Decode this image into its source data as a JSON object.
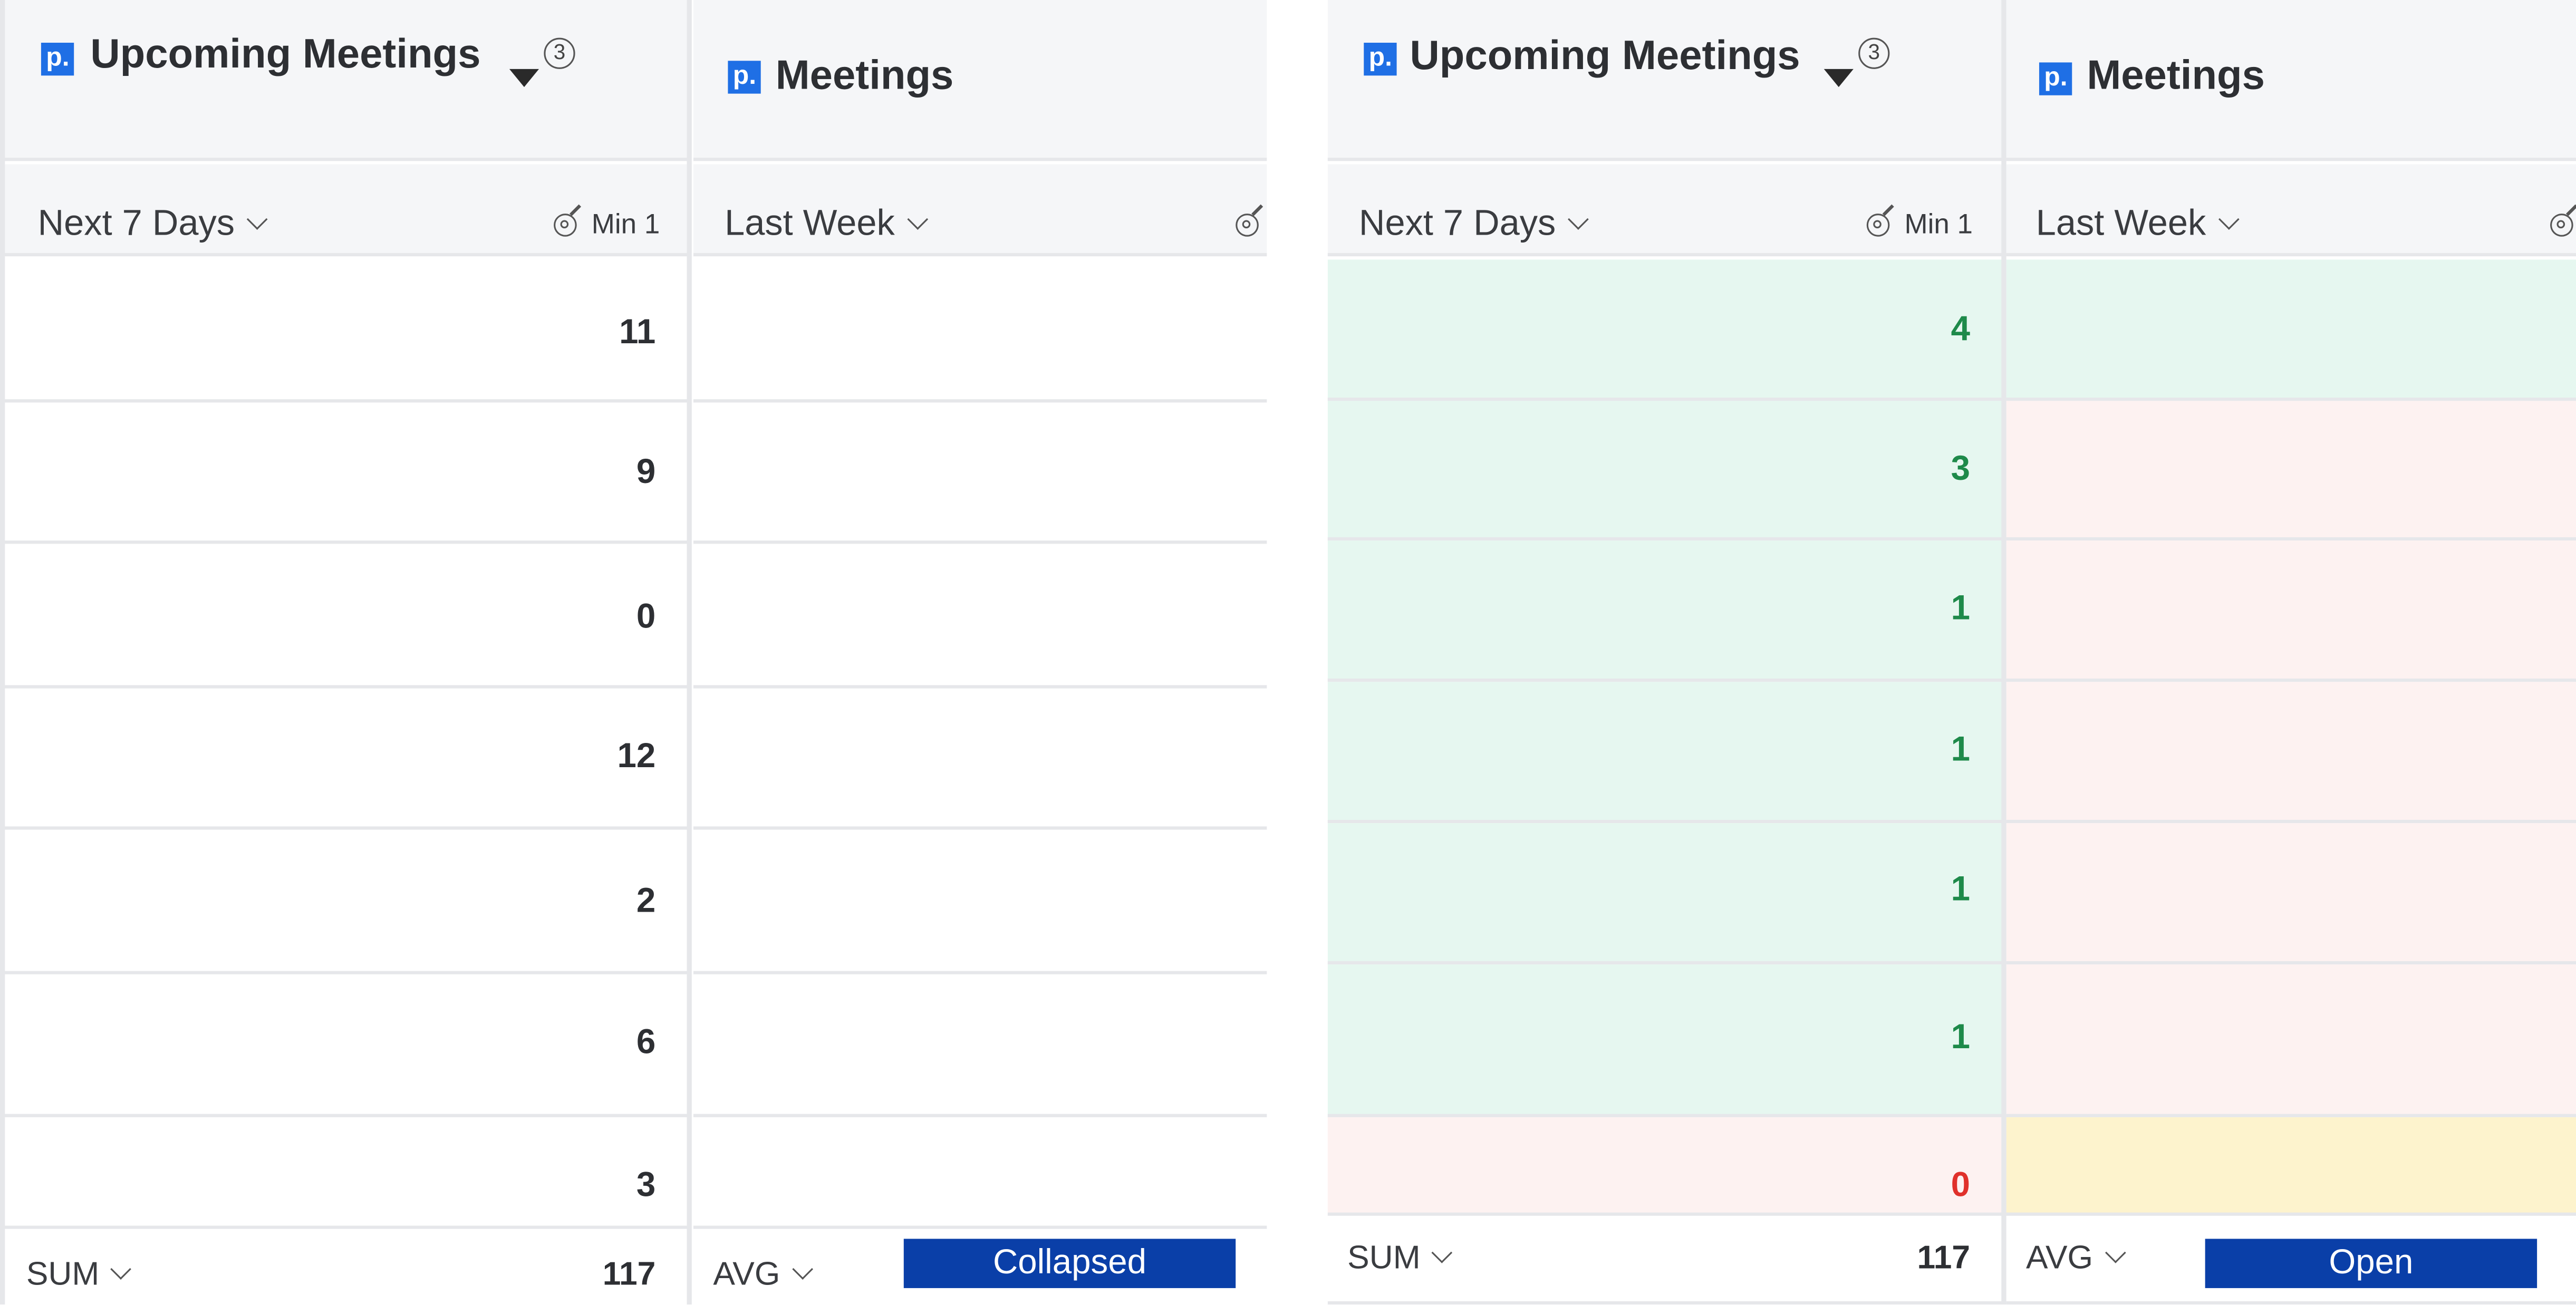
{
  "colors": {
    "header_bg": "#f5f6f8",
    "grid_line": "#e6e7ea",
    "pipedrive_blue": "#1f6fe5",
    "cell_green": "#e6f7f0",
    "cell_red": "#fdf2f1",
    "cell_yellow": "#fdf3cd",
    "value_green": "#1e8a4a",
    "value_red": "#e0312b",
    "button_blue": "#0a3fa8"
  },
  "panels": [
    {
      "state_label": "Collapsed",
      "upcoming": {
        "icon": "pipedrive-p-icon",
        "title": "Upcoming Meetings",
        "filter_icon": "filter-triangle-icon",
        "filter_count": "3",
        "range_label": "Next 7 Days",
        "goal_icon": "target-goal-icon",
        "goal_label": "Min 1",
        "values": [
          "11",
          "9",
          "0",
          "12",
          "2",
          "6",
          "3"
        ],
        "aggregate_label": "SUM",
        "aggregate_value": "117"
      },
      "meetings": {
        "icon": "pipedrive-p-icon",
        "title": "Meetings",
        "range_label": "Last Week",
        "goal_icon": "target-goal-icon",
        "aggregate_label": "AVG"
      }
    },
    {
      "state_label": "Open",
      "upcoming": {
        "icon": "pipedrive-p-icon",
        "title": "Upcoming Meetings",
        "filter_icon": "filter-triangle-icon",
        "filter_count": "3",
        "range_label": "Next 7 Days",
        "goal_icon": "target-goal-icon",
        "goal_label": "Min 1",
        "values": [
          "4",
          "3",
          "1",
          "1",
          "1",
          "1",
          "0"
        ],
        "value_status": [
          "green",
          "green",
          "green",
          "green",
          "green",
          "green",
          "red"
        ],
        "aggregate_label": "SUM",
        "aggregate_value": "117"
      },
      "meetings": {
        "icon": "pipedrive-p-icon",
        "title": "Meetings",
        "range_label": "Last Week",
        "goal_icon": "target-goal-icon",
        "cell_status": [
          "green",
          "red",
          "red",
          "red",
          "red",
          "red",
          "yellow"
        ],
        "aggregate_label": "AVG"
      }
    }
  ]
}
